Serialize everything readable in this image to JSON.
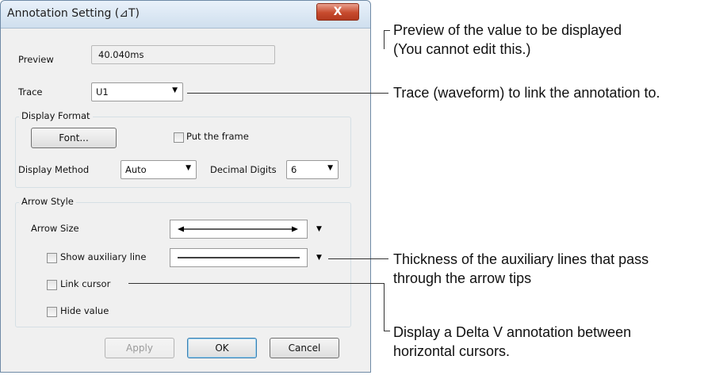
{
  "dialog": {
    "title": "Annotation Setting (⊿T)",
    "close_glyph": "X",
    "preview_label": "Preview",
    "preview_value": "40.040ms",
    "trace_label": "Trace",
    "trace_value": "U1",
    "display_format": {
      "group_title": "Display Format",
      "font_button": "Font...",
      "put_frame_label": "Put the frame",
      "put_frame_checked": false,
      "display_method_label": "Display Method",
      "display_method_value": "Auto",
      "decimal_digits_label": "Decimal Digits",
      "decimal_digits_value": "6"
    },
    "arrow_style": {
      "group_title": "Arrow Style",
      "arrow_size_label": "Arrow Size",
      "show_aux_label": "Show auxiliary line",
      "show_aux_checked": false,
      "link_cursor_label": "Link cursor",
      "link_cursor_checked": false,
      "hide_value_label": "Hide value",
      "hide_value_checked": false
    },
    "buttons": {
      "apply": "Apply",
      "ok": "OK",
      "cancel": "Cancel"
    }
  },
  "callouts": {
    "preview_line1": "Preview of the value to be displayed",
    "preview_line2": "(You cannot edit this.)",
    "trace": "Trace (waveform) to link the annotation to.",
    "thickness_line1": "Thickness of the auxiliary lines that pass",
    "thickness_line2": "through the arrow tips",
    "link_line1": "Display a Delta V annotation between",
    "link_line2": "horizontal cursors."
  },
  "icons": {
    "dropdown": "chevron-down-icon",
    "close": "close-icon"
  },
  "colors": {
    "close_button": "#c74b2e",
    "dialog_bg": "#f0f0f0",
    "titlebar": "#cfdfee"
  }
}
